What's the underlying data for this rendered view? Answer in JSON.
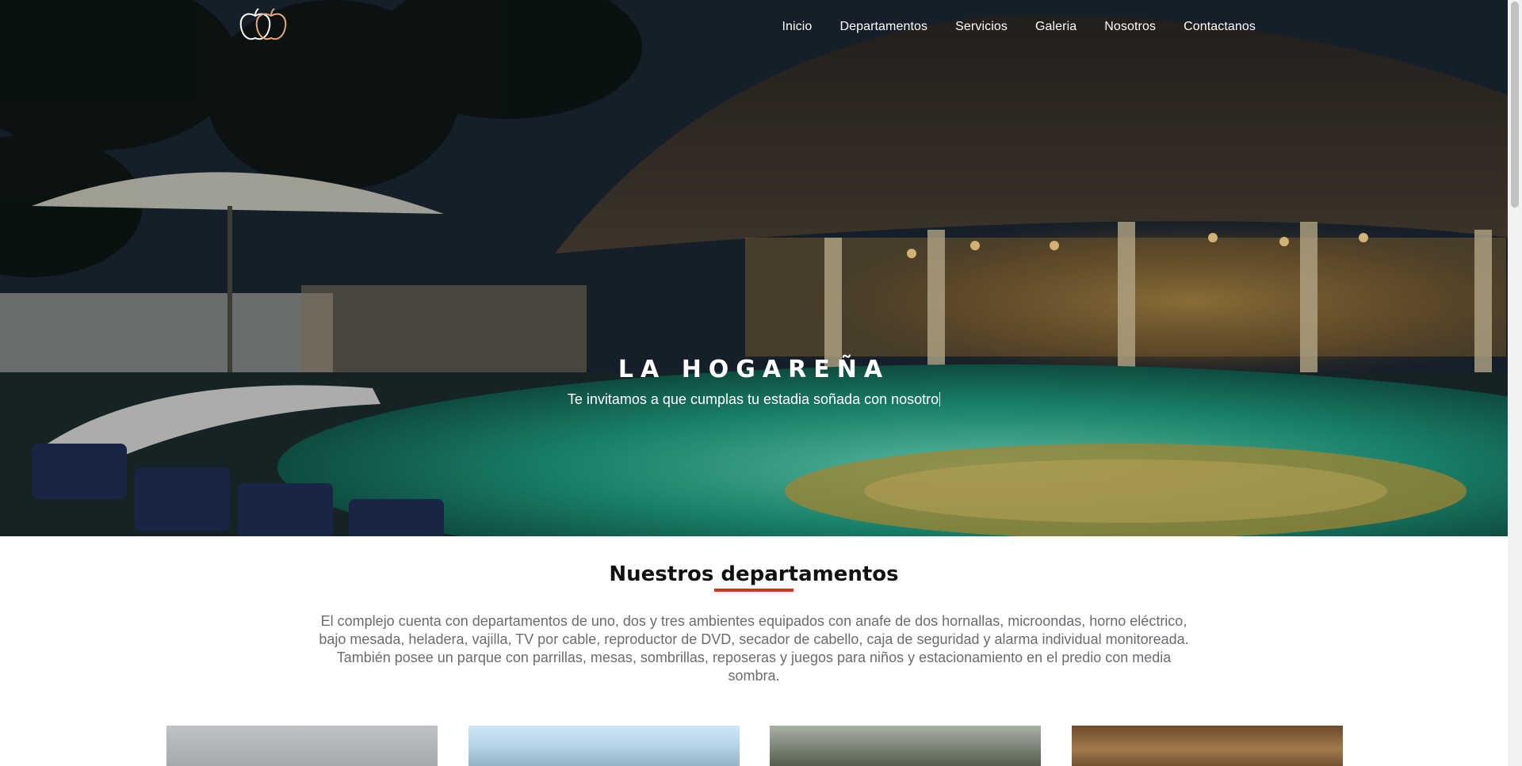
{
  "nav": {
    "items": [
      "Inicio",
      "Departamentos",
      "Servicios",
      "Galeria",
      "Nosotros",
      "Contactanos"
    ]
  },
  "hero": {
    "title": "LA HOGAREÑA",
    "subtitle": "Te invitamos a que cumplas tu estadia soñada con nosotro"
  },
  "section": {
    "title": "Nuestros departamentos",
    "text": "El complejo cuenta con departamentos de uno, dos y tres ambientes equipados con anafe de dos hornallas, microondas, horno eléctrico, bajo mesada, heladera, vajilla, TV por cable, reproductor de DVD, secador de cabello, caja de seguridad y alarma individual monitoreada. También posee un parque con parrillas, mesas, sombrillas, reposeras y juegos para niños y estacionamiento en el predio con media sombra."
  },
  "colors": {
    "accent": "#d2361d",
    "nav_text": "#ffffff",
    "body_text": "#6b6b72"
  },
  "icons": {
    "logo": "two-apples-icon"
  }
}
